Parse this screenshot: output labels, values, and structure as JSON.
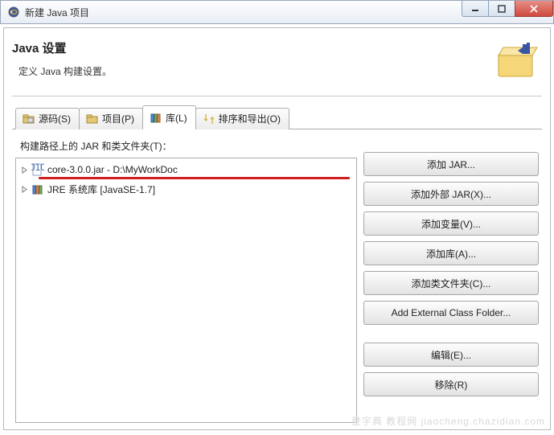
{
  "window": {
    "title": "新建 Java 项目"
  },
  "header": {
    "title": "Java 设置",
    "subtitle": "定义 Java 构建设置。"
  },
  "tabs": {
    "source": "源码(S)",
    "projects": "项目(P)",
    "libraries": "库(L)",
    "order": "排序和导出(O)"
  },
  "tree": {
    "label": "构建路径上的 JAR 和类文件夹(T)：",
    "rows": [
      {
        "text": "core-3.0.0.jar  -  D:\\MyWorkDoc"
      },
      {
        "text": "JRE 系统库 [JavaSE-1.7]"
      }
    ]
  },
  "buttons": {
    "add_jar": "添加 JAR...",
    "add_ext_jar": "添加外部 JAR(X)...",
    "add_var": "添加变量(V)...",
    "add_lib": "添加库(A)...",
    "add_class_folder": "添加类文件夹(C)...",
    "add_ext_class_folder": "Add External Class Folder...",
    "edit": "编辑(E)...",
    "remove": "移除(R)"
  },
  "watermark": "登字典 教程网  jiaocheng.chazidian.com"
}
